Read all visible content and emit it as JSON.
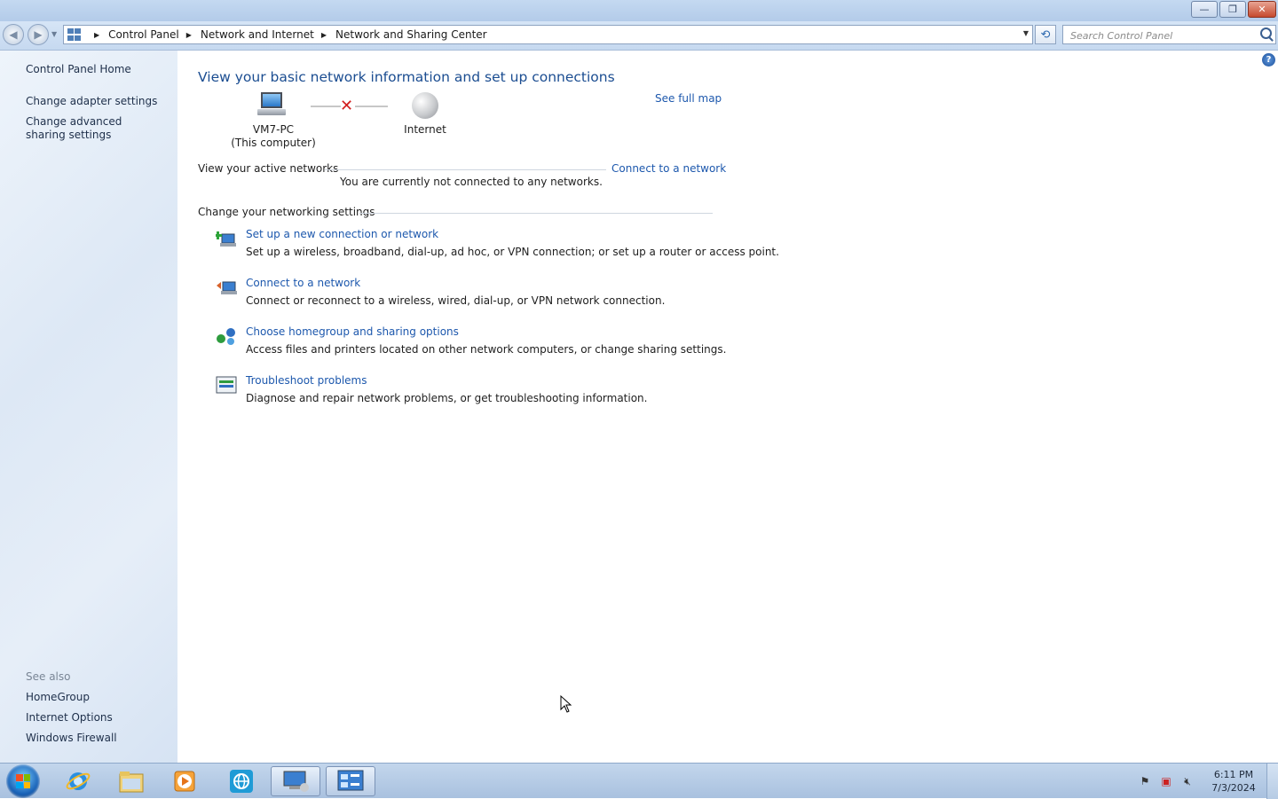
{
  "window": {
    "minimize_label": "—",
    "restore_label": "❐",
    "close_label": "✕"
  },
  "navigation": {
    "back_glyph": "◀",
    "forward_glyph": "▶",
    "breadcrumb": [
      "Control Panel",
      "Network and Internet",
      "Network and Sharing Center"
    ],
    "search_placeholder": "Search Control Panel"
  },
  "sidebar": {
    "home": "Control Panel Home",
    "items": [
      "Change adapter settings",
      "Change advanced sharing settings"
    ],
    "see_also_title": "See also",
    "see_also": [
      "HomeGroup",
      "Internet Options",
      "Windows Firewall"
    ]
  },
  "main": {
    "heading": "View your basic network information and set up connections",
    "see_full_map": "See full map",
    "computer_name": "VM7-PC",
    "computer_sub": "(This computer)",
    "internet_label": "Internet",
    "active_networks_title": "View your active networks",
    "connect_link": "Connect to a network",
    "not_connected": "You are currently not connected to any networks.",
    "settings_title": "Change your networking settings",
    "tasks": [
      {
        "icon": "new-connection-icon",
        "link": "Set up a new connection or network",
        "desc": "Set up a wireless, broadband, dial-up, ad hoc, or VPN connection; or set up a router or access point."
      },
      {
        "icon": "connect-network-icon",
        "link": "Connect to a network",
        "desc": "Connect or reconnect to a wireless, wired, dial-up, or VPN network connection."
      },
      {
        "icon": "homegroup-icon",
        "link": "Choose homegroup and sharing options",
        "desc": "Access files and printers located on other network computers, or change sharing settings."
      },
      {
        "icon": "troubleshoot-icon",
        "link": "Troubleshoot problems",
        "desc": "Diagnose and repair network problems, or get troubleshooting information."
      }
    ]
  },
  "taskbar": {
    "apps": [
      "internet-explorer-icon",
      "windows-explorer-icon",
      "media-player-icon",
      "network-app-icon",
      "remote-desktop-icon",
      "control-panel-icon"
    ],
    "time": "6:11 PM",
    "date": "7/3/2024"
  },
  "colors": {
    "link": "#1d58ad",
    "heading": "#1b4d91",
    "error_x": "#d21d1d"
  }
}
